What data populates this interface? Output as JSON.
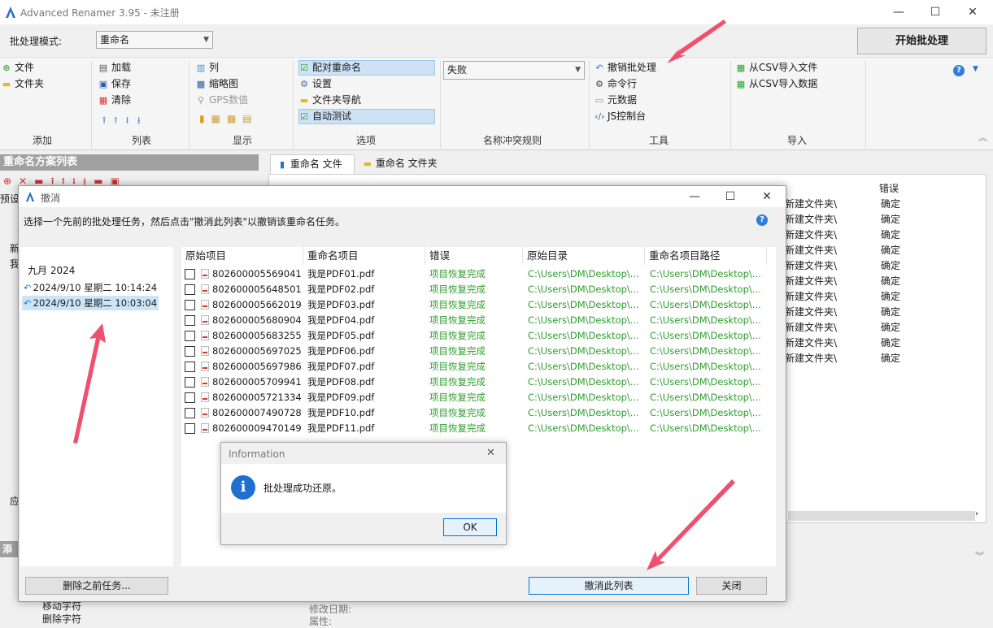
{
  "app": {
    "title": "Advanced Renamer 3.95 - 未注册",
    "window_controls": {
      "min": "—",
      "max": "☐",
      "close": "✕"
    }
  },
  "toolbar": {
    "mode_label": "批处理模式:",
    "mode_value": "重命名",
    "start_button": "开始批处理"
  },
  "ribbon": {
    "add": {
      "items": [
        "文件",
        "文件夹"
      ],
      "label": "添加"
    },
    "list": {
      "items": [
        "加载",
        "保存",
        "清除"
      ],
      "label": "列表",
      "arrows": "⭱⭡⭣⭳"
    },
    "display": {
      "items": [
        "列",
        "缩略图",
        "GPS数值"
      ],
      "label": "显示"
    },
    "options": {
      "items": [
        "配对重命名",
        "设置",
        "文件夹导航",
        "自动测试"
      ],
      "label": "选项"
    },
    "conflict": {
      "value": "失败",
      "label": "名称冲突规则"
    },
    "tools": {
      "items": [
        "撤销批处理",
        "命令行",
        "元数据",
        "JS控制台"
      ],
      "label": "工具"
    },
    "import": {
      "items": [
        "从CSV导入文件",
        "从CSV导入数据"
      ],
      "label": "导入"
    },
    "collapse": "︽",
    "help": "?"
  },
  "left_panel": {
    "header": "重命名方案列表",
    "fragments": [
      "预设",
      "新",
      "我",
      "应",
      "添"
    ]
  },
  "tabs": [
    {
      "label": "重命名 文件"
    },
    {
      "label": "重命名 文件夹"
    }
  ],
  "bg_table": {
    "error_header": "错误",
    "path_value": "新建文件夹\\",
    "ok_value": "确定",
    "row_count_visible": 11
  },
  "undo_dialog": {
    "title": "撤消",
    "controls": {
      "min": "—",
      "max": "☐",
      "close": "✕"
    },
    "instruction": "选择一个先前的批处理任务，然后点击\"撤消此列表\"以撤销该重命名任务。",
    "help": "?",
    "tree": {
      "month": "九月 2024",
      "entries": [
        "2024/9/10 星期二 10:14:24",
        "2024/9/10 星期二 10:03:04"
      ]
    },
    "columns": [
      "原始项目",
      "重命名项目",
      "错误",
      "原始目录",
      "重命名项目路径"
    ],
    "rows": [
      {
        "orig": "8026000055690418...",
        "new": "我是PDF01.pdf",
        "err": "项目恢复完成",
        "dir": "C:\\Users\\DM\\Desktop\\...",
        "path": "C:\\Users\\DM\\Desktop\\..."
      },
      {
        "orig": "8026000056485018...",
        "new": "我是PDF02.pdf",
        "err": "项目恢复完成",
        "dir": "C:\\Users\\DM\\Desktop\\...",
        "path": "C:\\Users\\DM\\Desktop\\..."
      },
      {
        "orig": "8026000056620198...",
        "new": "我是PDF03.pdf",
        "err": "项目恢复完成",
        "dir": "C:\\Users\\DM\\Desktop\\...",
        "path": "C:\\Users\\DM\\Desktop\\..."
      },
      {
        "orig": "8026000056809048...",
        "new": "我是PDF04.pdf",
        "err": "项目恢复完成",
        "dir": "C:\\Users\\DM\\Desktop\\...",
        "path": "C:\\Users\\DM\\Desktop\\..."
      },
      {
        "orig": "8026000056832558...",
        "new": "我是PDF05.pdf",
        "err": "项目恢复完成",
        "dir": "C:\\Users\\DM\\Desktop\\...",
        "path": "C:\\Users\\DM\\Desktop\\..."
      },
      {
        "orig": "8026000056970258...",
        "new": "我是PDF06.pdf",
        "err": "项目恢复完成",
        "dir": "C:\\Users\\DM\\Desktop\\...",
        "path": "C:\\Users\\DM\\Desktop\\..."
      },
      {
        "orig": "8026000056979868...",
        "new": "我是PDF07.pdf",
        "err": "项目恢复完成",
        "dir": "C:\\Users\\DM\\Desktop\\...",
        "path": "C:\\Users\\DM\\Desktop\\..."
      },
      {
        "orig": "8026000057099418...",
        "new": "我是PDF08.pdf",
        "err": "项目恢复完成",
        "dir": "C:\\Users\\DM\\Desktop\\...",
        "path": "C:\\Users\\DM\\Desktop\\..."
      },
      {
        "orig": "8026000057213348...",
        "new": "我是PDF09.pdf",
        "err": "项目恢复完成",
        "dir": "C:\\Users\\DM\\Desktop\\...",
        "path": "C:\\Users\\DM\\Desktop\\..."
      },
      {
        "orig": "8026000074907288...",
        "new": "我是PDF10.pdf",
        "err": "项目恢复完成",
        "dir": "C:\\Users\\DM\\Desktop\\...",
        "path": "C:\\Users\\DM\\Desktop\\..."
      },
      {
        "orig": "8026000094701498...",
        "new": "我是PDF11.pdf",
        "err": "项目恢复完成",
        "dir": "C:\\Users\\DM\\Desktop\\...",
        "path": "C:\\Users\\DM\\Desktop\\..."
      }
    ],
    "delete_button": "删除之前任务...",
    "undo_button": "撤消此列表",
    "close_button": "关闭"
  },
  "info_dialog": {
    "title": "Information",
    "close": "✕",
    "icon": "i",
    "message": "批处理成功还原。",
    "ok": "OK"
  },
  "underlay": [
    "移动字符",
    "删除字符",
    "修改日期:",
    "属性:"
  ],
  "colors": {
    "accent": "#0078d7",
    "success_text": "#2e9d2e",
    "arrow": "#f0506e"
  }
}
